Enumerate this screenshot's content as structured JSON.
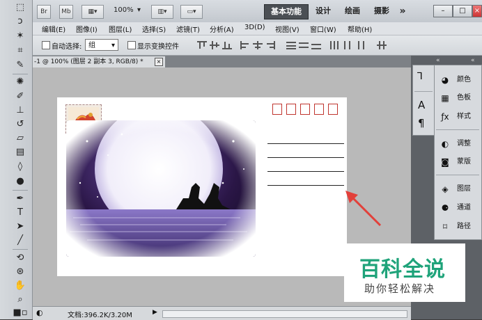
{
  "titlebar": {
    "br_label": "Br",
    "mb_label": "Mb",
    "zoom": "100%",
    "workspaces": [
      "基本功能",
      "设计",
      "绘画",
      "摄影"
    ],
    "more_label": "»",
    "win_min": "–",
    "win_max": "□",
    "win_close": "×"
  },
  "menus": [
    "编辑(E)",
    "图像(I)",
    "图层(L)",
    "选择(S)",
    "滤镜(T)",
    "分析(A)",
    "3D(D)",
    "视图(V)",
    "窗口(W)",
    "帮助(H)"
  ],
  "options": {
    "auto_select_label": "自动选择:",
    "auto_select_value": "组",
    "show_transform_label": "显示变换控件"
  },
  "document": {
    "tab_title": "-1 @ 100% (图层 2 副本 3, RGB/8) *",
    "close_label": "×"
  },
  "status": {
    "doc_info": "文档:396.2K/3.20M",
    "arrow_label": "▶"
  },
  "panels": {
    "dock1": [
      "history-icon",
      "character-icon",
      "paragraph-icon"
    ],
    "dock2": [
      {
        "label": "颜色",
        "icon": "color-icon"
      },
      {
        "label": "色板",
        "icon": "swatches-icon"
      },
      {
        "label": "样式",
        "icon": "styles-icon"
      },
      {
        "label": "调整",
        "icon": "adjustments-icon"
      },
      {
        "label": "蒙版",
        "icon": "masks-icon"
      },
      {
        "label": "图层",
        "icon": "layers-icon"
      },
      {
        "label": "通道",
        "icon": "channels-icon"
      },
      {
        "label": "路径",
        "icon": "paths-icon"
      }
    ]
  },
  "watermark": {
    "title": "百科全说",
    "subtitle": "助你轻松解决"
  },
  "colors": {
    "accent_green": "#1fa37a",
    "zip_red": "#c0352f",
    "arrow_red": "#e2403a"
  }
}
